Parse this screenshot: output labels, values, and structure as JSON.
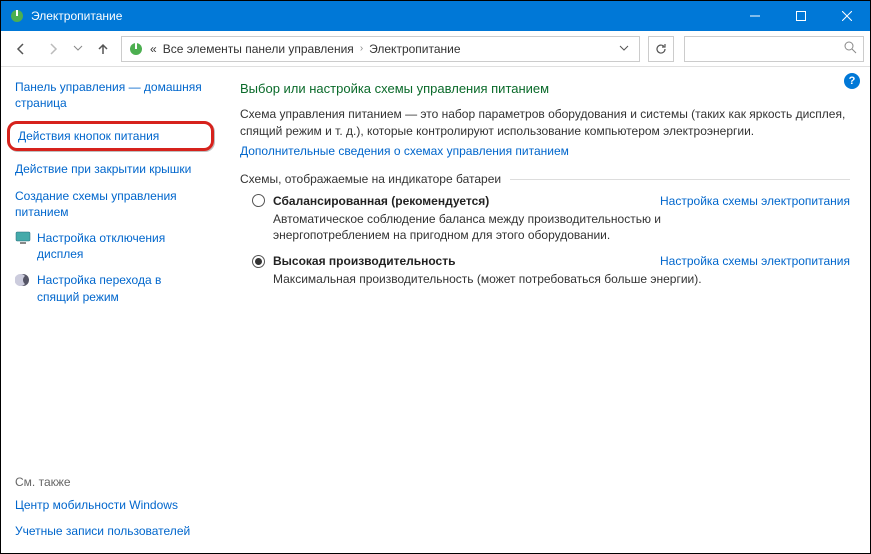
{
  "window": {
    "title": "Электропитание"
  },
  "breadcrumb": {
    "prefix": "«",
    "parent": "Все элементы панели управления",
    "current": "Электропитание"
  },
  "sidebar": {
    "home": "Панель управления — домашняя страница",
    "highlighted": "Действия кнопок питания",
    "links": {
      "lid": "Действие при закрытии крышки",
      "create": "Создание схемы управления питанием",
      "display": "Настройка отключения дисплея",
      "sleep": "Настройка перехода в спящий режим"
    },
    "see_also_label": "См. также",
    "see_also": {
      "mobility": "Центр мобильности Windows",
      "accounts": "Учетные записи пользователей"
    }
  },
  "main": {
    "heading": "Выбор или настройка схемы управления питанием",
    "description": "Схема управления питанием — это набор параметров оборудования и системы (таких как яркость дисплея, спящий режим и т. д.), которые контролируют использование компьютером электроэнергии.",
    "more_link": "Дополнительные сведения о схемах управления питанием",
    "group_label": "Схемы, отображаемые на индикаторе батареи",
    "settings_link": "Настройка схемы электропитания",
    "plans": [
      {
        "name": "Сбалансированная (рекомендуется)",
        "desc": "Автоматическое соблюдение баланса между производительностью и энергопотреблением на пригодном для этого оборудовании.",
        "selected": false
      },
      {
        "name": "Высокая производительность",
        "desc": "Максимальная производительность (может потребоваться больше энергии).",
        "selected": true
      }
    ]
  }
}
